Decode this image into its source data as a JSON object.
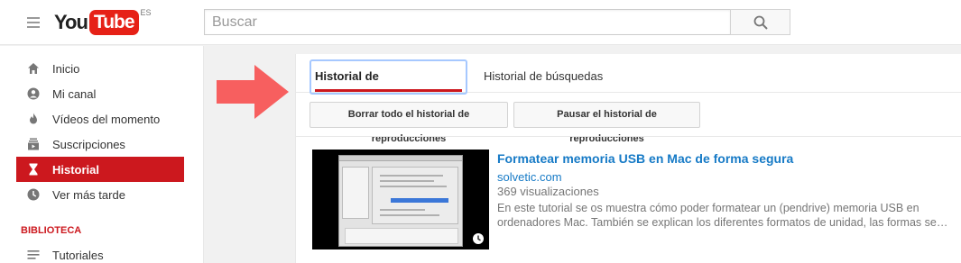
{
  "colors": {
    "brand_red": "#cc181e",
    "link_blue": "#167ac6",
    "annotation_arrow": "#f75f5f"
  },
  "header": {
    "logo_you": "You",
    "logo_tube": "Tube",
    "logo_country": "ES",
    "search_placeholder": "Buscar",
    "icons": {
      "menu": "hamburger-menu-icon",
      "search": "search-icon"
    }
  },
  "sidebar": {
    "items": [
      {
        "label": "Inicio",
        "icon": "home-icon",
        "active": false
      },
      {
        "label": "Mi canal",
        "icon": "account-icon",
        "active": false
      },
      {
        "label": "Vídeos del momento",
        "icon": "flame-icon",
        "active": false
      },
      {
        "label": "Suscripciones",
        "icon": "subscriptions-icon",
        "active": false
      },
      {
        "label": "Historial",
        "icon": "hourglass-icon",
        "active": true
      },
      {
        "label": "Ver más tarde",
        "icon": "clock-icon",
        "active": false
      }
    ],
    "section_title": "BIBLIOTECA",
    "library": [
      {
        "label": "Tutoriales",
        "icon": "playlist-icon"
      }
    ]
  },
  "main": {
    "tabs": [
      {
        "label": "Historial de reproducciones",
        "active": true
      },
      {
        "label": "Historial de búsquedas",
        "active": false
      }
    ],
    "buttons": {
      "clear": "Borrar todo el historial de reproducciones",
      "pause": "Pausar el historial de reproducciones"
    },
    "videos": [
      {
        "title": "Formatear memoria USB en Mac de forma segura",
        "channel": "solvetic.com",
        "views": "369 visualizaciones",
        "description_lines": [
          "En este tutorial se os muestra cómo poder formatear un (pendrive) memoria USB en",
          "ordenadores Mac. También se explican los diferentes formatos de unidad, las formas segur…"
        ],
        "watch_later_icon": "clock-icon"
      }
    ]
  }
}
